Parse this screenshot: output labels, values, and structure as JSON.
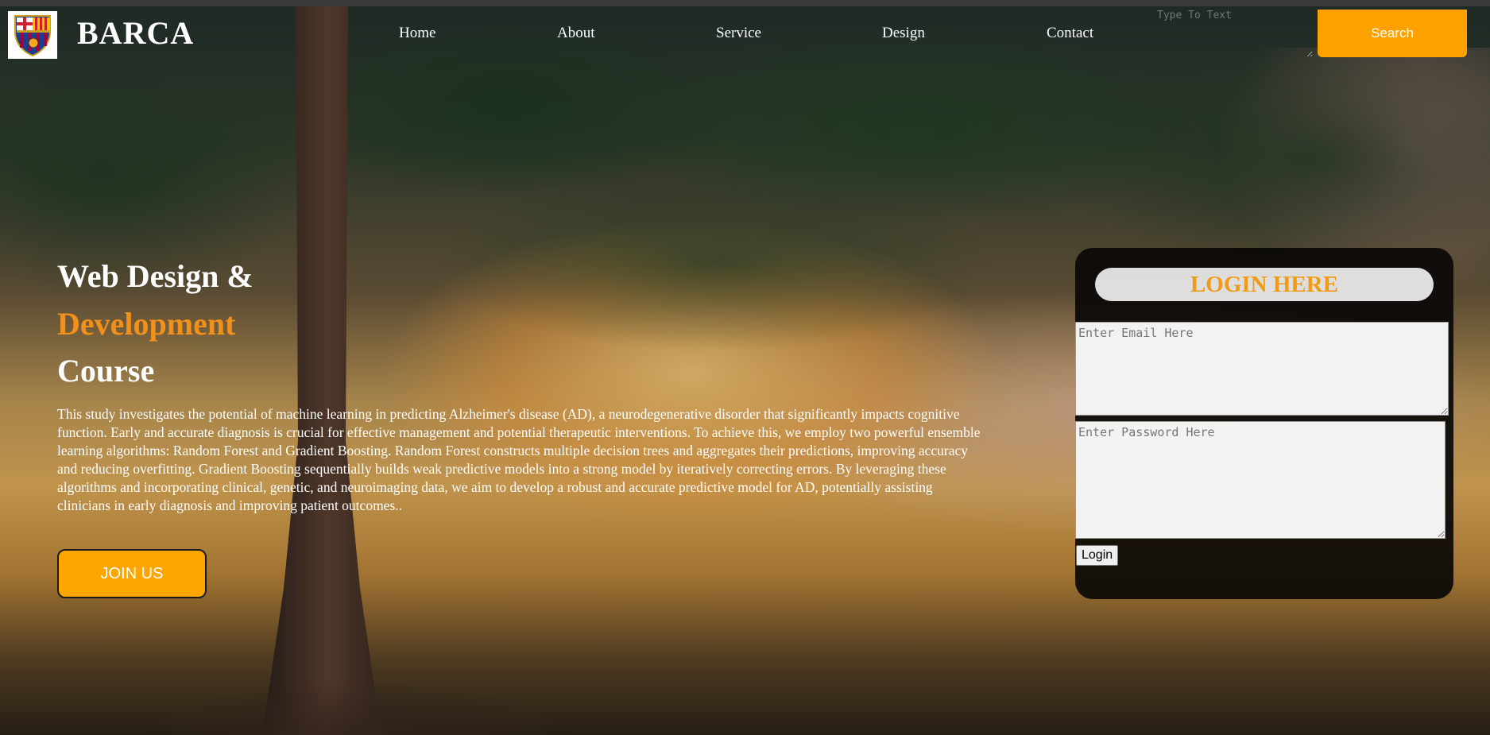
{
  "header": {
    "brand": "BARCA",
    "logo_icon": "fc-barcelona-crest-icon",
    "nav": [
      "Home",
      "About",
      "Service",
      "Design",
      "Contact"
    ],
    "search_placeholder": "Type To Text",
    "search_button": "Search"
  },
  "hero": {
    "title_line1": "Web Design &",
    "title_line2": "Development",
    "title_line3": "Course",
    "description": "This study investigates the potential of machine learning in predicting Alzheimer's disease (AD), a neurodegenerative disorder that significantly impacts cognitive function. Early and accurate diagnosis is crucial for effective management and potential therapeutic interventions. To achieve this, we employ two powerful ensemble learning algorithms: Random Forest and Gradient Boosting. Random Forest constructs multiple decision trees and aggregates their predictions, improving accuracy and reducing overfitting. Gradient Boosting sequentially builds weak predictive models into a strong model by iteratively correcting errors. By leveraging these algorithms and incorporating clinical, genetic, and neuroimaging data, we aim to develop a robust and accurate predictive model for AD, potentially assisting clinicians in early diagnosis and improving patient outcomes..",
    "join_button": "JOIN US"
  },
  "login": {
    "title": "LOGIN HERE",
    "email_placeholder": "Enter Email Here",
    "password_placeholder": "Enter Password Here",
    "login_button": "Login"
  },
  "colors": {
    "accent": "#ffa500",
    "title_orange": "#f2901c",
    "card_bg": "#0a0806"
  }
}
